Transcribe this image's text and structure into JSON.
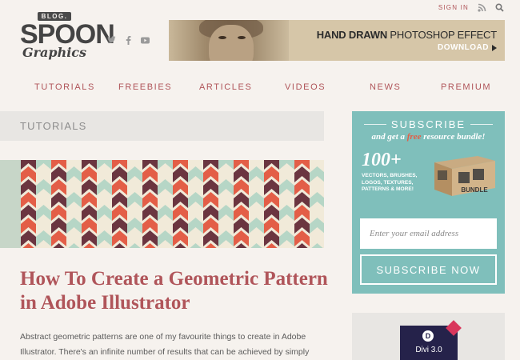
{
  "header": {
    "signin_label": "SIGN IN",
    "logo": {
      "blog": "BLOG.",
      "spoon": "SPOON",
      "graphics": "Graphics"
    },
    "banner": {
      "headline_bold": "HAND DRAWN",
      "headline_rest": " PHOTOSHOP EFFECT",
      "cta": "DOWNLOAD"
    }
  },
  "nav": {
    "items": [
      "TUTORIALS",
      "FREEBIES",
      "ARTICLES",
      "VIDEOS",
      "NEWS",
      "PREMIUM"
    ]
  },
  "section": {
    "title": "TUTORIALS"
  },
  "post": {
    "title": "How To Create a Geometric Pattern in Adobe Illustrator",
    "excerpt": "Abstract geometric patterns are one of my favourite things to create in Adobe Illustrator. There's an infinite number of results that can be achieved by simply changing up the"
  },
  "subscribe": {
    "title": "SUBSCRIBE",
    "tagline_pre": "and get a ",
    "tagline_free": "free",
    "tagline_post": " resource bundle!",
    "count": "100+",
    "items_text": "VECTORS, BRUSHES, LOGOS, TEXTURES, PATTERNS & MORE!",
    "bundle_label": "BUNDLE",
    "email_placeholder": "Enter your email address",
    "button_label": "SUBSCRIBE NOW"
  },
  "sidebar_ad": {
    "product": "Divi 3.0",
    "badge": "NEW",
    "logo_letter": "D"
  },
  "icons": [
    "rss-icon",
    "search-icon",
    "twitter-icon",
    "facebook-icon",
    "youtube-icon",
    "play-arrow-icon"
  ],
  "colors": {
    "accent": "#b0555a",
    "teal": "#7fbfbb",
    "pattern_maroon": "#6b3540",
    "pattern_orange": "#e35e47",
    "pattern_mint": "#b6d6c6",
    "pattern_cream": "#f1ead9"
  }
}
